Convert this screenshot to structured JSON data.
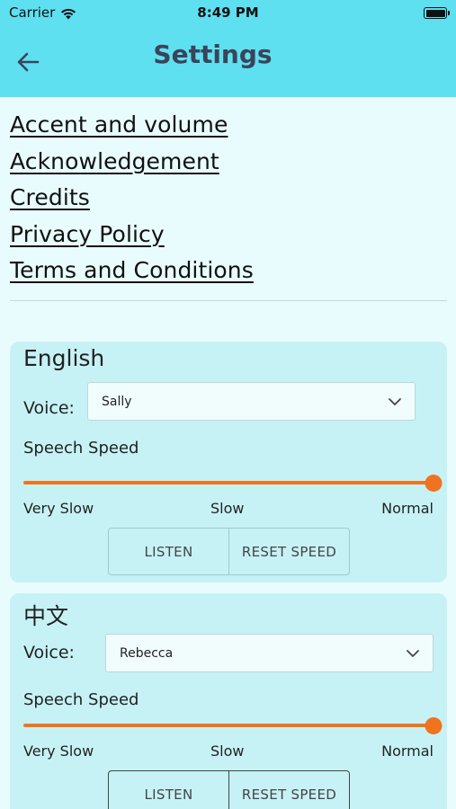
{
  "status_bar": {
    "carrier": "Carrier",
    "time": "8:49 PM"
  },
  "header": {
    "title": "Settings"
  },
  "links": [
    "Accent and volume",
    "Acknowledgement",
    "Credits",
    "Privacy Policy",
    "Terms and Conditions"
  ],
  "languages": [
    {
      "name": "English",
      "voice_label": "Voice:",
      "voice_value": "Sally",
      "speed_label": "Speech Speed",
      "speed_value": 1.0,
      "ticks": [
        "Very Slow",
        "Slow",
        "Normal"
      ],
      "listen_label": "LISTEN",
      "reset_label": "RESET SPEED"
    },
    {
      "name": "中文",
      "voice_label": "Voice:",
      "voice_value": "Rebecca",
      "speed_label": "Speech Speed",
      "speed_value": 1.0,
      "ticks": [
        "Very Slow",
        "Slow",
        "Normal"
      ],
      "listen_label": "LISTEN",
      "reset_label": "RESET SPEED"
    }
  ],
  "colors": {
    "header_bg": "#5ee0f1",
    "page_bg": "#e9fcfd",
    "card_bg": "#c6f2f6",
    "slider": "#f07420",
    "title": "#3b4458"
  },
  "icons": {
    "back": "arrow-left-icon",
    "dropdown": "chevron-down-icon",
    "wifi": "wifi-icon",
    "battery": "battery-icon"
  }
}
